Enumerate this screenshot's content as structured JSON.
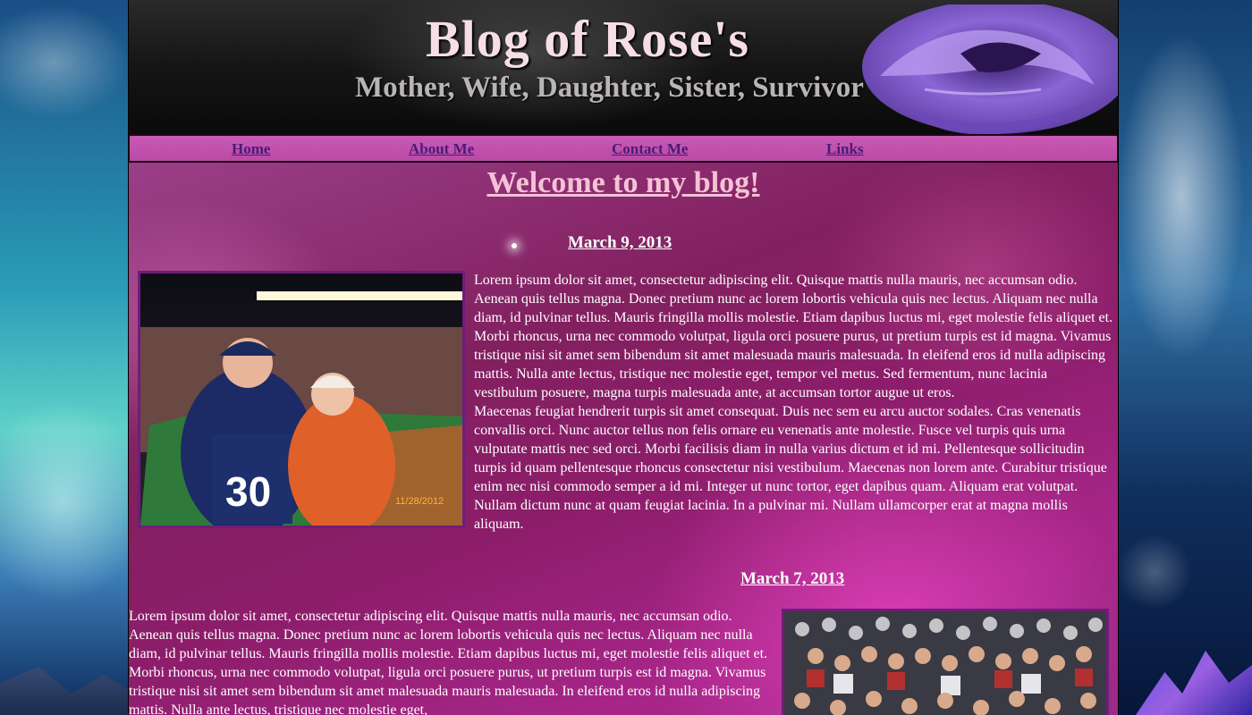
{
  "banner": {
    "title": "Blog of Rose's",
    "subtitle": "Mother, Wife, Daughter, Sister, Survivor"
  },
  "nav": {
    "items": [
      {
        "label": "Home"
      },
      {
        "label": "About Me"
      },
      {
        "label": "Contact Me"
      },
      {
        "label": "Links"
      }
    ]
  },
  "main": {
    "welcome": "Welcome to my blog!",
    "posts": [
      {
        "date": "March 9, 2013",
        "photo_caption_date": "11/28/2012",
        "paragraphs": [
          "Lorem ipsum dolor sit amet, consectetur adipiscing elit. Quisque mattis nulla mauris, nec accumsan odio. Aenean quis tellus magna. Donec pretium nunc ac lorem lobortis vehicula quis nec lectus. Aliquam nec nulla diam, id pulvinar tellus. Mauris fringilla mollis molestie. Etiam dapibus luctus mi, eget molestie felis aliquet et. Morbi rhoncus, urna nec commodo volutpat, ligula orci posuere purus, ut pretium turpis est id magna. Vivamus tristique nisi sit amet sem bibendum sit amet malesuada mauris malesuada. In eleifend eros id nulla adipiscing mattis. Nulla ante lectus, tristique nec molestie eget, tempor vel metus. Sed fermentum, nunc lacinia vestibulum posuere, magna turpis malesuada ante, at accumsan tortor augue ut eros.",
          "Maecenas feugiat hendrerit turpis sit amet consequat. Duis nec sem eu arcu auctor sodales. Cras venenatis convallis orci. Nunc auctor tellus non felis ornare eu venenatis ante molestie. Fusce vel turpis quis urna vulputate mattis nec sed orci. Morbi facilisis diam in nulla varius dictum et id mi. Pellentesque sollicitudin turpis id quam pellentesque rhoncus consectetur nisi vestibulum. Maecenas non lorem ante. Curabitur tristique enim nec nisi commodo semper a id mi. Integer ut nunc tortor, eget dapibus quam. Aliquam erat volutpat. Nullam dictum nunc at quam feugiat lacinia. In a pulvinar mi. Nullam ullamcorper erat at magna mollis aliquam."
        ]
      },
      {
        "date": "March 7, 2013",
        "paragraphs": [
          "Lorem ipsum dolor sit amet, consectetur adipiscing elit. Quisque mattis nulla mauris, nec accumsan odio. Aenean quis tellus magna. Donec pretium nunc ac lorem lobortis vehicula quis nec lectus. Aliquam nec nulla diam, id pulvinar tellus. Mauris fringilla mollis molestie. Etiam dapibus luctus mi, eget molestie felis aliquet et. Morbi rhoncus, urna nec commodo volutpat, ligula orci posuere purus, ut pretium turpis est id magna. Vivamus tristique nisi sit amet sem bibendum sit amet malesuada mauris malesuada. In eleifend eros id nulla adipiscing mattis. Nulla ante lectus, tristique nec molestie eget,"
        ]
      }
    ]
  },
  "colors": {
    "nav_bg": "#c95ab4",
    "nav_link": "#4a1a7a",
    "welcome": "#f4c2d6",
    "photo_border": "#6f1d7a",
    "content_bg": "#82205f"
  }
}
